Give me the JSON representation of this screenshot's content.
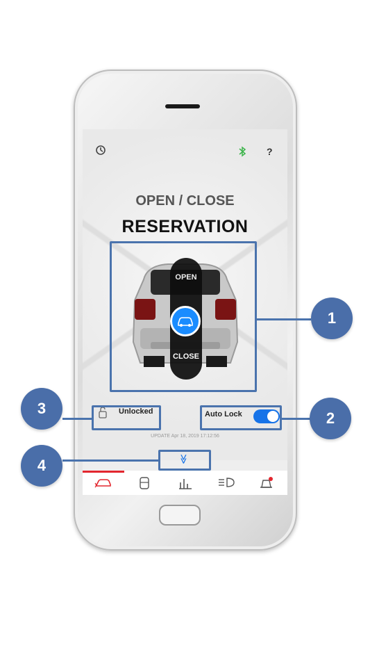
{
  "header": {
    "power_icon": "power-icon",
    "bluetooth_icon": "bluetooth-icon",
    "help_label": "?"
  },
  "main": {
    "title_line1": "OPEN / CLOSE",
    "title_line2": "RESERVATION",
    "open_label": "OPEN",
    "close_label": "CLOSE"
  },
  "status": {
    "lock_label": "Unlocked",
    "auto_lock_label": "Auto Lock",
    "auto_lock_on": true,
    "update_text": "UPDATE Apr 18, 2019 17:12:56"
  },
  "expand": {
    "chevron_glyph": "≫"
  },
  "tabs": [
    {
      "icon": "car-remote-icon",
      "active": true
    },
    {
      "icon": "door-icon",
      "active": false
    },
    {
      "icon": "bar-chart-icon",
      "active": false
    },
    {
      "icon": "headlight-icon",
      "active": false
    },
    {
      "icon": "alarm-bell-icon",
      "active": false
    }
  ],
  "callouts": [
    "1",
    "2",
    "3",
    "4"
  ],
  "colors": {
    "callout": "#4a6ea9",
    "accent": "#1673e8",
    "active_tab": "#e3262e"
  }
}
